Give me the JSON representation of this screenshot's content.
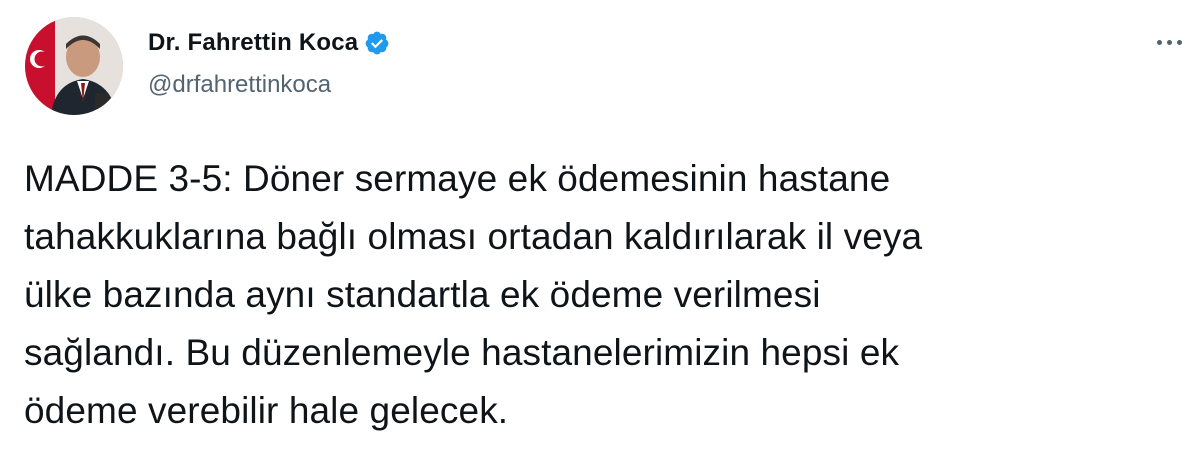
{
  "author": {
    "display_name": "Dr. Fahrettin Koca",
    "handle": "@drfahrettinkoca",
    "verified": true,
    "avatar_icon": "profile-photo"
  },
  "tweet": {
    "text_lines": [
      "MADDE 3-5: Döner sermaye ek ödemesinin hastane",
      "tahakkuklarına bağlı olması ortadan kaldırılarak il veya",
      "ülke bazında aynı standartla ek ödeme verilmesi",
      "sağlandı. Bu düzenlemeyle hastanelerimizin hepsi ek",
      "ödeme verebilir hale gelecek."
    ]
  },
  "icons": {
    "verified": "verified-badge-icon",
    "more": "more-options-icon"
  },
  "colors": {
    "verified_blue": "#1d9bf0",
    "text_primary": "#0f1419",
    "text_secondary": "#536471"
  }
}
